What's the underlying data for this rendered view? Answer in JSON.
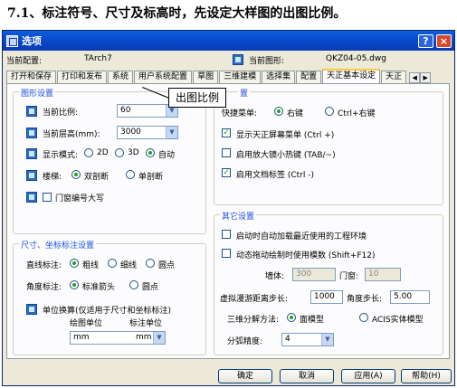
{
  "heading": "7.1、标注符号、尺寸及标高时，先设定大样图的出图比例。",
  "window": {
    "title": "选项",
    "help_btn": "?",
    "close_btn": "×"
  },
  "config": {
    "current_config_label": "当前配置:",
    "current_config_value": "TArch7",
    "current_drawing_label": "当前图形:",
    "current_drawing_value": "QKZ04-05.dwg"
  },
  "tabs": [
    "打开和保存",
    "打印和发布",
    "系统",
    "用户系统配置",
    "草图",
    "三维建模",
    "选择集",
    "配置",
    "天正基本设定",
    "天正"
  ],
  "active_tab": "天正基本设定",
  "graphics": {
    "legend": "图形设置",
    "scale_label": "当前比例:",
    "scale_value": "60",
    "floor_height_label": "当前层高(mm):",
    "floor_height_value": "3000",
    "display_mode_label": "显示模式:",
    "display_mode_options": [
      "2D",
      "3D",
      "自动"
    ],
    "stairs_label": "楼梯:",
    "stairs_options": [
      "双剖断",
      "单剖断"
    ],
    "door_window_upper": "门窗编号大写"
  },
  "callout": "出图比例",
  "dimension": {
    "legend": "尺寸、坐标标注设置",
    "linear_label": "直线标注:",
    "linear_options": [
      "粗线",
      "细线",
      "圆点"
    ],
    "angle_label": "角度标注:",
    "angle_options": [
      "标准箭头",
      "圆点"
    ],
    "unit_convert_label": "单位换算(仅适用于尺寸和坐标标注)",
    "drawing_unit_label": "绘图单位",
    "drawing_unit_value": "mm",
    "annotation_unit_label": "标注单位",
    "annotation_unit_value": "mm"
  },
  "menu": {
    "legend": "置",
    "shortcut_label": "快捷菜单:",
    "shortcut_options": [
      "右键",
      "Ctrl+右键"
    ],
    "show_screen_menu": "显示天正屏幕菜单 (Ctrl +)",
    "zoom_thumbnail": "启用放大镜小热键 (TAB/~)",
    "doc_tabs": "启用文档标签 (Ctrl -)"
  },
  "other": {
    "legend": "其它设置",
    "auto_load": "启动时自动加载最近使用的工程环境",
    "dynamic_drag": "动态拖动绘制时使用模数 (Shift+F12)",
    "wall_label": "墙体:",
    "wall_value": "300",
    "door_label": "门窗:",
    "door_value": "10",
    "roaming_step_label": "虚拟漫游距离步长:",
    "roaming_step_value": "1000",
    "angle_step_label": "角度步长:",
    "angle_step_value": "5.00",
    "decompose_label": "三维分解方法:",
    "decompose_options": [
      "面模型",
      "ACIS实体模型"
    ],
    "arc_precision_label": "分弧精度:",
    "arc_precision_value": "4"
  },
  "buttons": {
    "ok": "确定",
    "cancel": "取消",
    "apply": "应用(A)",
    "help": "帮助(H)"
  }
}
